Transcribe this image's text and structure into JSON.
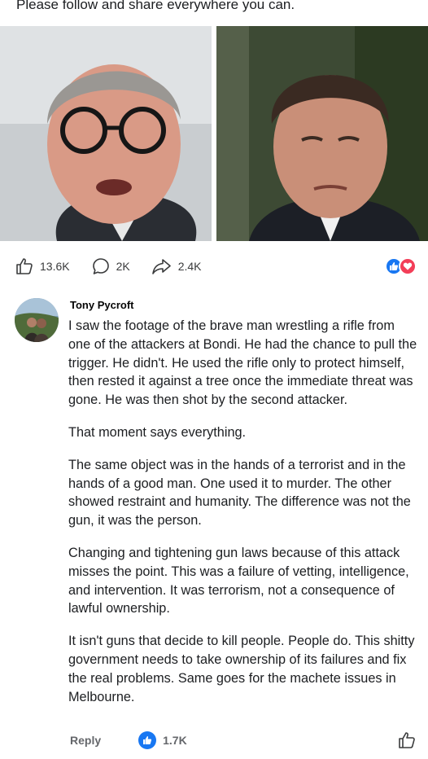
{
  "caption": "Please follow and share everywhere you can.",
  "post": {
    "like_count": "13.6K",
    "comment_count": "2K",
    "share_count": "2.4K",
    "reactions": [
      "like",
      "love"
    ]
  },
  "comment": {
    "author": "Tony Pycroft",
    "paragraphs": [
      "I saw the footage of the brave man wrestling a rifle from one of the attackers at Bondi. He had the chance to pull the trigger. He didn't. He used the rifle only to protect himself, then rested it against a tree once the immediate threat was gone. He was then shot by the second attacker.",
      "That moment says everything.",
      "The same object was in the hands of a terrorist and in the hands of a good man. One used it to murder. The other showed restraint and humanity. The difference was not the gun, it was the person.",
      "Changing and tightening gun laws because of this attack misses the point. This was a failure of vetting, intelligence, and intervention. It was terrorism, not a consequence of lawful ownership.",
      "It isn't guns that decide to kill people. People do. This shitty government needs to take ownership of its failures and fix the real problems. Same goes for the machete issues in Melbourne."
    ],
    "reply_label": "Reply",
    "like_count": "1.7K"
  },
  "colors": {
    "like_blue": "#1877f2",
    "love_red": "#f33e58",
    "meta_gray": "#65676b"
  }
}
